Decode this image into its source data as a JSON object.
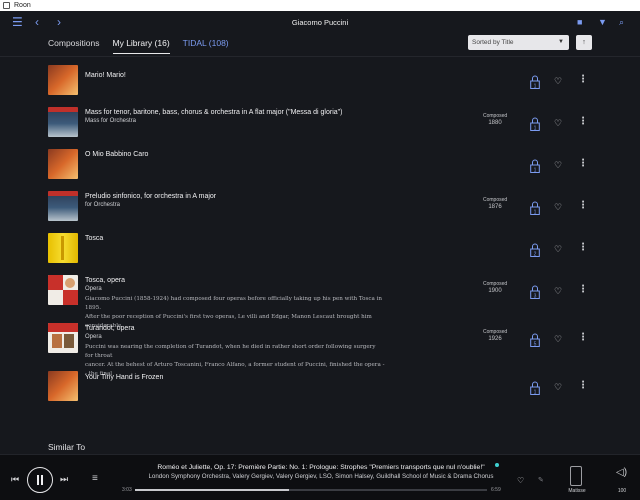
{
  "window": {
    "title": "Roon"
  },
  "topbar": {
    "title": "Giacomo Puccini"
  },
  "tabs": [
    {
      "label": "Compositions"
    },
    {
      "label": "My Library (16)"
    },
    {
      "label": "TIDAL (108)"
    }
  ],
  "sort": {
    "label": "Sorted by Title",
    "direction_icon": "arrow-up-icon"
  },
  "items": [
    {
      "title": "Mario! Mario!",
      "subtitle": "",
      "composed_label": "",
      "composed_year": "",
      "lock_num": "1",
      "desc1": "",
      "desc2": ""
    },
    {
      "title": "Mass for tenor, baritone, bass, chorus & orchestra in A flat major (\"Messa di gloria\")",
      "subtitle": "Mass for Orchestra",
      "composed_label": "Composed",
      "composed_year": "1880",
      "lock_num": "1",
      "desc1": "",
      "desc2": ""
    },
    {
      "title": "O Mio Babbino Caro",
      "subtitle": "",
      "composed_label": "",
      "composed_year": "",
      "lock_num": "1",
      "desc1": "",
      "desc2": ""
    },
    {
      "title": "Preludio sinfonico, for orchestra in A major",
      "subtitle": "for Orchestra",
      "composed_label": "Composed",
      "composed_year": "1876",
      "lock_num": "1",
      "desc1": "",
      "desc2": ""
    },
    {
      "title": "Tosca",
      "subtitle": "",
      "composed_label": "",
      "composed_year": "",
      "lock_num": "2",
      "desc1": "",
      "desc2": ""
    },
    {
      "title": "Tosca, opera",
      "subtitle": "Opera",
      "composed_label": "Composed",
      "composed_year": "1900",
      "lock_num": "3",
      "desc1": "Giacomo Puccini (1858-1924) had composed four operas before officially taking up his pen with Tosca in 1895.",
      "desc2": "After the poor reception of Puccini's first two operas, Le villi and Edgar, Manon Lescaut brought him considerable"
    },
    {
      "title": "Turandot, opera",
      "subtitle": "Opera",
      "composed_label": "Composed",
      "composed_year": "1926",
      "lock_num": "5",
      "desc1": "Puccini was nearing the completion of Turandot, when he died in rather short order following surgery for throat",
      "desc2": "cancer. At the behest of Arturo Toscanini, Franco Alfano, a former student of Puccini, finished the opera -- the final"
    },
    {
      "title": "Your Tiny Hand is Frozen",
      "subtitle": "",
      "composed_label": "",
      "composed_year": "",
      "lock_num": "1",
      "desc1": "",
      "desc2": ""
    }
  ],
  "similar": {
    "label": "Similar To"
  },
  "player": {
    "track": "Roméo et Juliette, Op. 17: Première Partie: No. 1: Prologue: Strophes \"Premiers transports que nul n'oublie!\"",
    "artists": "London Symphony Orchestra, Valery Gergiev, Valery Gergiev, LSO, Simon Halsey, Guildhall School of Music & Drama Chorus",
    "time_current": "3:03",
    "time_total": "6:59",
    "progress": 0.437,
    "zone": "Matisse",
    "volume": "100"
  },
  "colors": {
    "accent": "#7b9bf0",
    "background": "#16181d",
    "player_bg": "#0d0e11"
  }
}
